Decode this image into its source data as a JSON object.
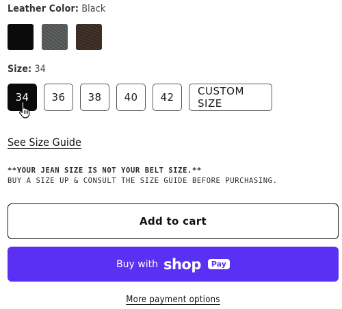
{
  "leather_color": {
    "label": "Leather Color:",
    "value": "Black",
    "swatches": [
      {
        "name": "Black",
        "color": "#0b0b0b",
        "selected": true
      },
      {
        "name": "Gray",
        "color": "#555656",
        "selected": false
      },
      {
        "name": "Brown",
        "color": "#3a2a22",
        "selected": false
      }
    ]
  },
  "size": {
    "label": "Size:",
    "value": "34",
    "options": [
      "34",
      "36",
      "38",
      "40",
      "42",
      "CUSTOM SIZE"
    ],
    "selected": "34"
  },
  "size_guide_link": "See Size Guide",
  "notes": {
    "line1": "**YOUR JEAN SIZE IS NOT YOUR BELT SIZE.**",
    "line2": "BUY A SIZE UP & CONSULT THE SIZE GUIDE BEFORE PURCHASING."
  },
  "buttons": {
    "add_to_cart": "Add to cart",
    "buy_with": "Buy with",
    "shop_brand": "shop",
    "pay_badge": "Pay",
    "more_payment": "More payment options"
  },
  "colors": {
    "shop_pay_purple": "#5a31f4",
    "selected_size_bg": "#0a0a0a"
  },
  "icons": {
    "cursor": "hand-pointer-icon"
  }
}
